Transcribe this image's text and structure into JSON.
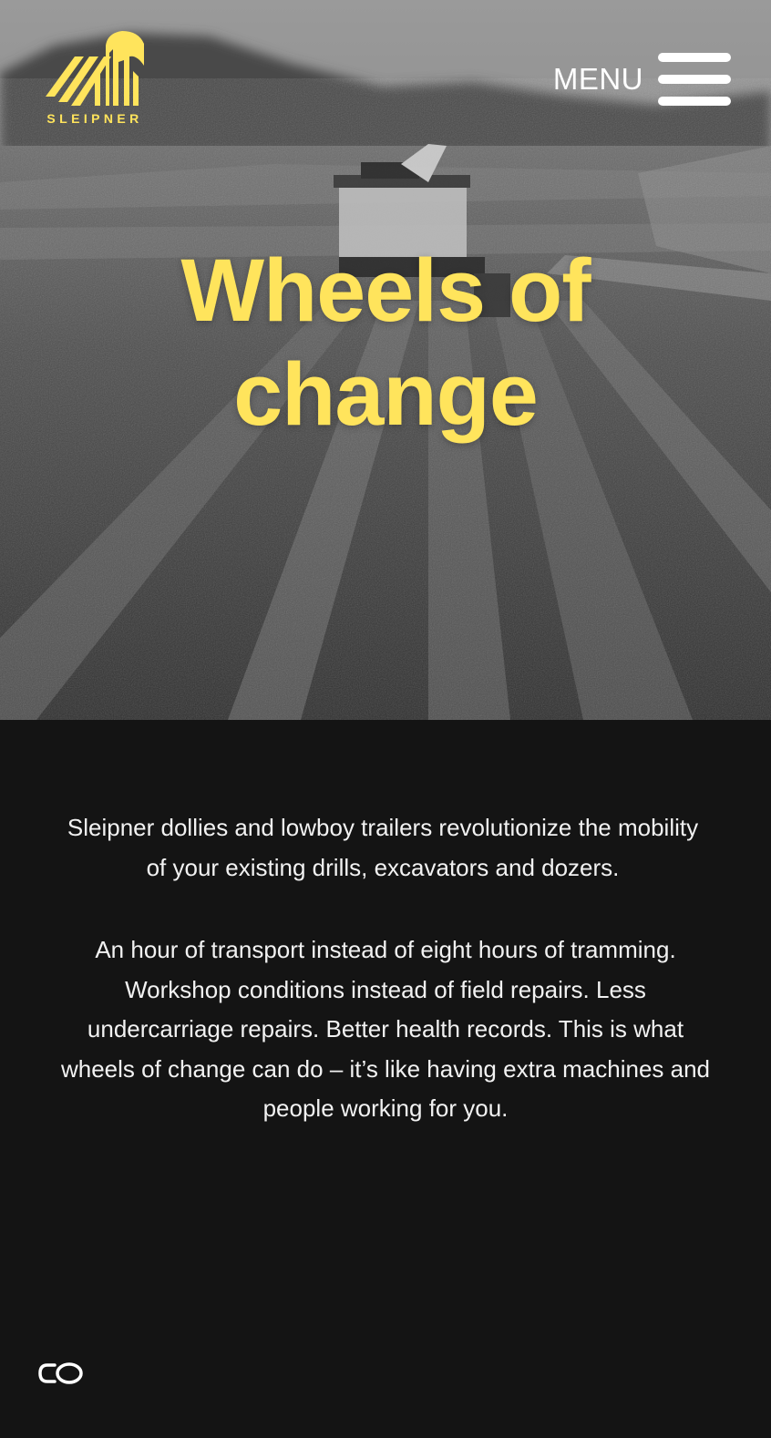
{
  "header": {
    "logo_text": "SLEIPNER",
    "menu_label": "MENU"
  },
  "hero": {
    "title_line1": "Wheels of",
    "title_line2": "change"
  },
  "main": {
    "paragraph_1": "Sleipner dollies and lowboy trailers revolutionize the mobility of your existing drills, excavators and dozers.",
    "paragraph_2": "An hour of transport instead of eight hours of tramming. Workshop conditions instead of field repairs. Less undercarriage repairs. Better health records. This is what wheels of change can do – it’s like having extra machines and people working for you."
  },
  "footer": {
    "cookie_icon": "cookie-settings-icon"
  },
  "colors": {
    "brand_yellow": "#ffe45c",
    "background": "#141414",
    "text": "#f2f2f2"
  }
}
